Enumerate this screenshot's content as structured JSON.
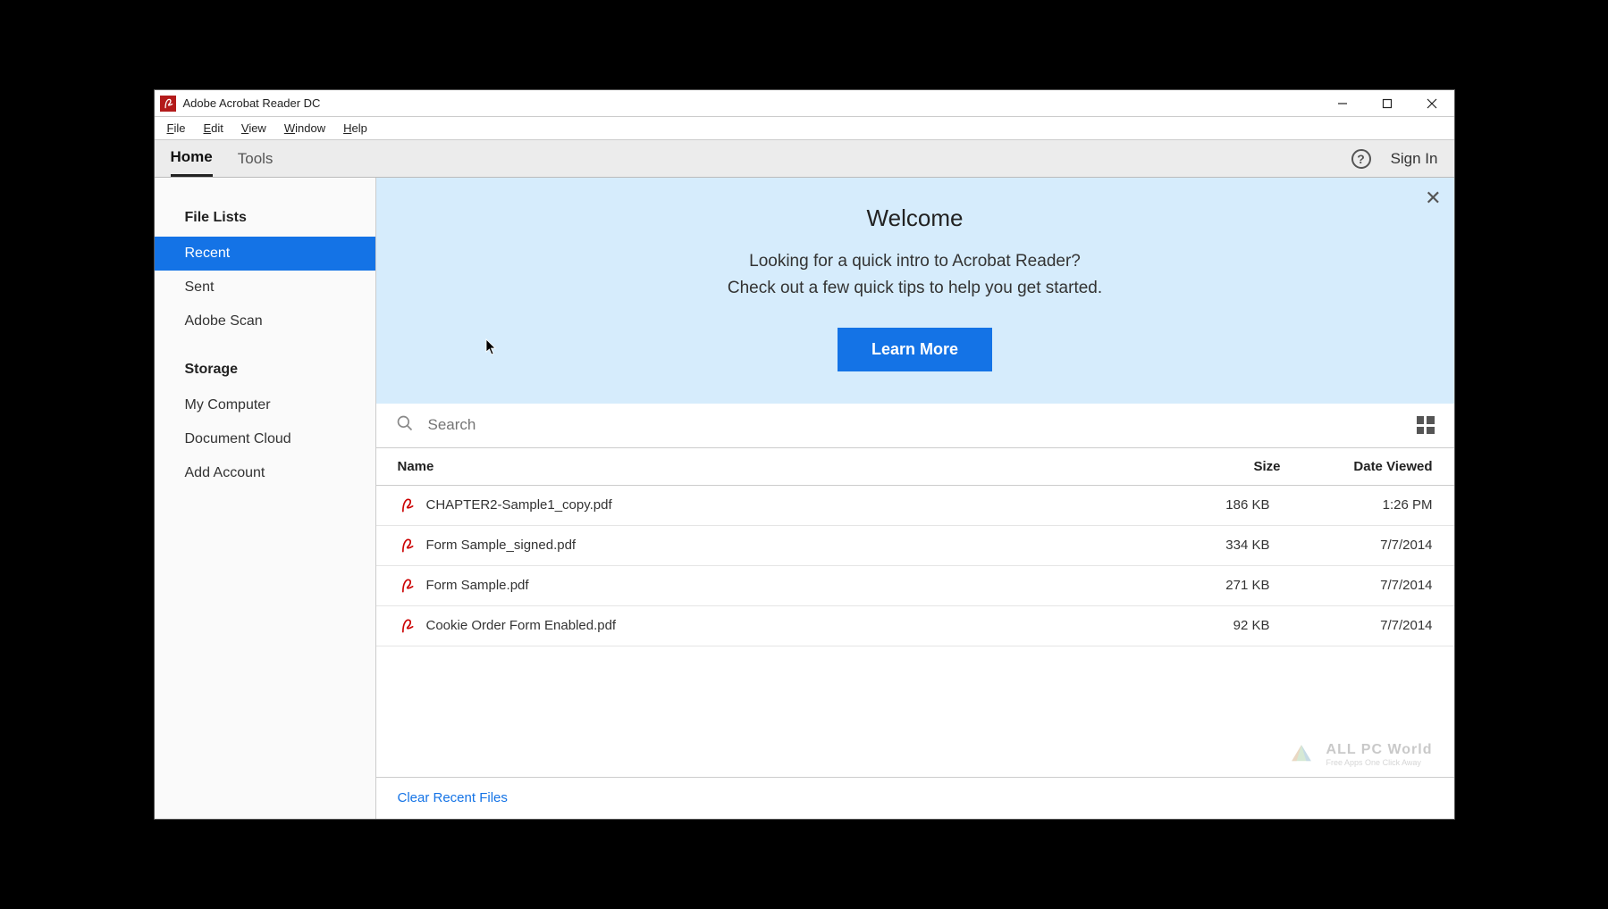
{
  "window": {
    "title": "Adobe Acrobat Reader DC"
  },
  "menubar": {
    "file": "File",
    "edit": "Edit",
    "view": "View",
    "window": "Window",
    "help": "Help"
  },
  "toolbar": {
    "tabs": {
      "home": "Home",
      "tools": "Tools"
    },
    "signin": "Sign In"
  },
  "sidebar": {
    "section1_header": "File Lists",
    "items1": {
      "recent": "Recent",
      "sent": "Sent",
      "adobe_scan": "Adobe Scan"
    },
    "section2_header": "Storage",
    "items2": {
      "my_computer": "My Computer",
      "document_cloud": "Document Cloud",
      "add_account": "Add Account"
    }
  },
  "banner": {
    "title": "Welcome",
    "line1": "Looking for a quick intro to Acrobat Reader?",
    "line2": "Check out a few quick tips to help you get started.",
    "button": "Learn More"
  },
  "search": {
    "placeholder": "Search"
  },
  "table": {
    "headers": {
      "name": "Name",
      "size": "Size",
      "date": "Date Viewed"
    },
    "rows": [
      {
        "name": "CHAPTER2-Sample1_copy.pdf",
        "size": "186 KB",
        "date": "1:26 PM"
      },
      {
        "name": "Form Sample_signed.pdf",
        "size": "334 KB",
        "date": "7/7/2014"
      },
      {
        "name": "Form Sample.pdf",
        "size": "271 KB",
        "date": "7/7/2014"
      },
      {
        "name": "Cookie Order Form Enabled.pdf",
        "size": "92 KB",
        "date": "7/7/2014"
      }
    ]
  },
  "footer": {
    "clear": "Clear Recent Files"
  },
  "watermark": {
    "text": "ALL PC World",
    "sub": "Free Apps One Click Away"
  }
}
